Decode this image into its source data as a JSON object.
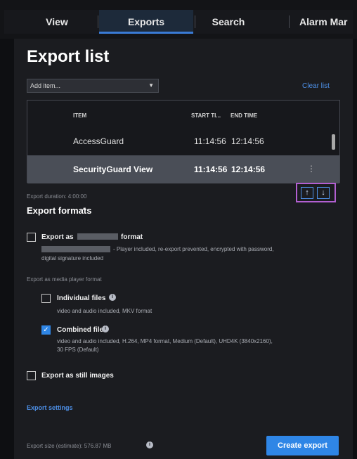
{
  "tabs": [
    {
      "label": "View"
    },
    {
      "label": "Exports"
    },
    {
      "label": "Search"
    },
    {
      "label": "Alarm Mar"
    }
  ],
  "page_title": "Export list",
  "add_item": {
    "value": "Add item...",
    "caret": "▼"
  },
  "clear_list": "Clear list",
  "table": {
    "columns": [
      "ITEM",
      "START TI...",
      "END TIME"
    ],
    "rows": [
      {
        "item": "AccessGuard",
        "start": "11:14:56",
        "end": "12:14:56"
      },
      {
        "item": "SecurityGuard View",
        "start": "11:14:56",
        "end": "12:14:56",
        "selected": true
      }
    ]
  },
  "export_duration": "Export duration: 4:00:00",
  "move_buttons": {
    "up": "↑",
    "down": "↓"
  },
  "export_formats": {
    "title": "Export formats",
    "chevron": "^",
    "format_option": {
      "label_prefix": "Export as",
      "label_suffix": "format",
      "desc_line1": "- Player included, re-export prevented, encrypted with password,",
      "desc_line2": "digital signature included",
      "checked": false
    },
    "media_player_caption": "Export as media player format",
    "individual": {
      "label": "Individual files",
      "desc": "video and audio included, MKV format",
      "checked": false
    },
    "combined": {
      "label": "Combined file",
      "desc_line1": "video and audio included, H.264, MP4 format, Medium (Default), UHD4K (3840x2160),",
      "desc_line2": "30 FPS (Default)",
      "checked": true
    },
    "still": {
      "label": "Export as still images",
      "checked": false
    }
  },
  "export_settings": "Export settings",
  "export_size": "Export size (estimate): 576.87 MB",
  "info_glyph": "i",
  "check_glyph": "✓",
  "create_export": "Create export",
  "colors": {
    "accent": "#2f86e6",
    "highlight": "#b25fd1"
  }
}
